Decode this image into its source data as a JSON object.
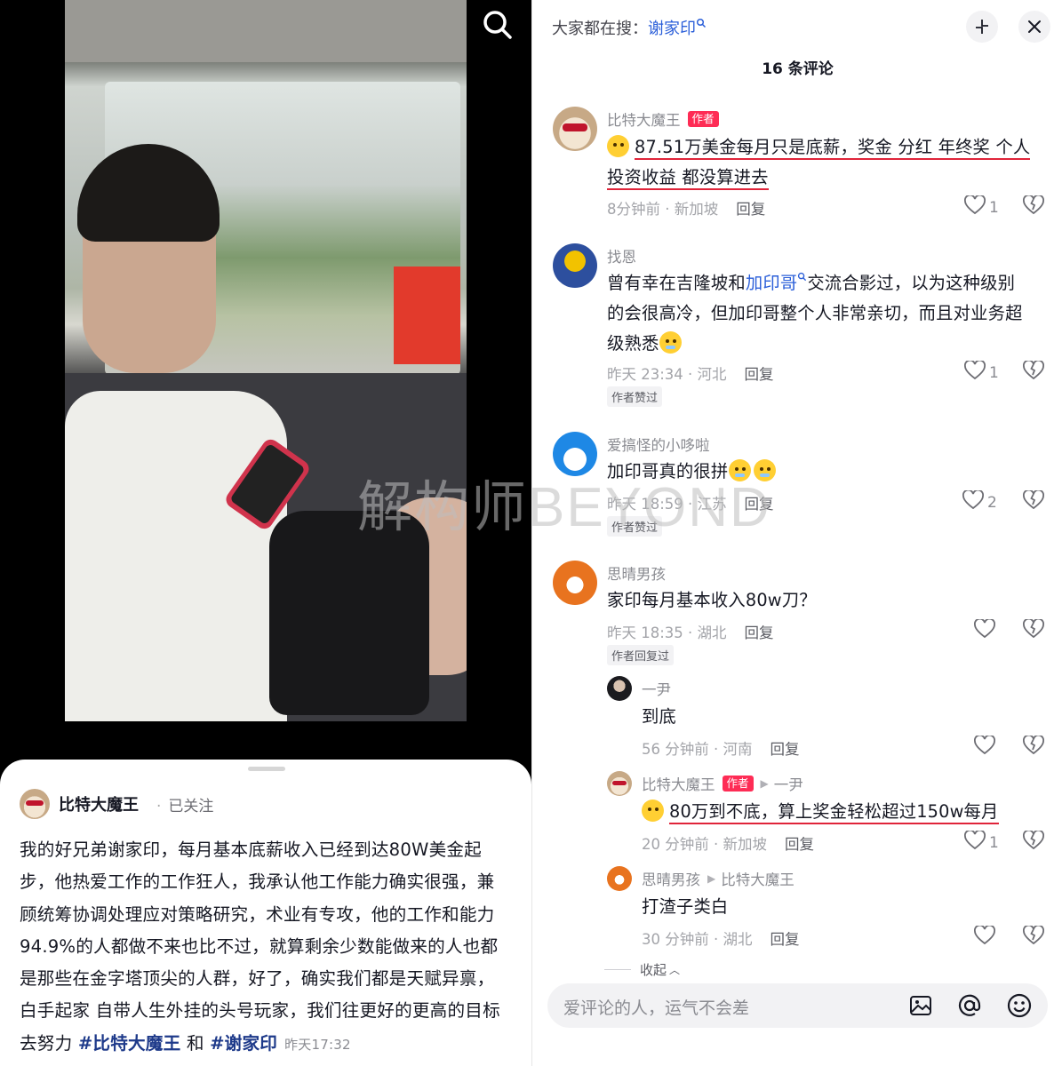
{
  "post": {
    "author": "比特大魔王",
    "follow_status": "已关注",
    "text": "我的好兄弟谢家印，每月基本底薪收入已经到达80W美金起步，他热爱工作的工作狂人，我承认他工作能力确实很强，兼顾统筹协调处理应对策略研究，术业有专攻，他的工作和能力94.9%的人都做不来也比不过，就算剩余少数能做来的人也都是那些在金字塔顶尖的人群，好了，确实我们都是天赋异禀，白手起家 自带人生外挂的头号玩家，我们往更好的更高的目标去努力 ",
    "hashtag1": "#比特大魔王",
    "joiner": " 和 ",
    "hashtag2": "#谢家印",
    "time": "昨天17:32"
  },
  "comments_panel": {
    "search_prefix": "大家都在搜：",
    "search_keyword": "谢家印",
    "count_label": "16 条评论",
    "collapse_label": "收起",
    "input_placeholder": "爱评论的人，运气不会差",
    "author_tag": "作者"
  },
  "comments": [
    {
      "name": "比特大魔王",
      "text": "87.51万美金每月只是底薪，奖金 分红 年终奖 个人投资收益 都没算进去",
      "line1": "87.51万美金每月只是底薪，奖金 分红 年终奖 个人",
      "line2": "投资收益 都没算进去",
      "meta": "8分钟前 · 新加坡",
      "reply": "回复",
      "likes": "1"
    },
    {
      "name": "找恩",
      "text_a": "曾有幸在吉隆坡和",
      "link": "加印哥",
      "text_b": "交流合影过，以为这种级别",
      "line2": "的会很高冷，但加印哥整个人非常亲切，而且对业务超",
      "line3": "级熟悉",
      "meta": "昨天 23:34 · 河北",
      "reply": "回复",
      "likes": "1",
      "badge": "作者赞过"
    },
    {
      "name": "爱搞怪的小哆啦",
      "text": "加印哥真的很拼",
      "meta": "昨天 18:59 · 江苏",
      "reply": "回复",
      "likes": "2",
      "badge": "作者赞过"
    },
    {
      "name": "思晴男孩",
      "text": "家印每月基本收入80w刀？",
      "meta": "昨天 18:35 · 湖北",
      "reply": "回复",
      "badge": "作者回复过"
    }
  ],
  "replies": [
    {
      "name": "一尹",
      "text": "到底",
      "meta": "56 分钟前 · 河南",
      "reply": "回复"
    },
    {
      "name": "比特大魔王",
      "to": "一尹",
      "text": "80万到不底，算上奖金轻松超过150w每月",
      "meta": "20 分钟前 · 新加坡",
      "reply": "回复",
      "likes": "1"
    },
    {
      "name": "思晴男孩",
      "to": "比特大魔王",
      "text": "打渣子类白",
      "meta": "30 分钟前 · 湖北",
      "reply": "回复"
    }
  ],
  "watermark": "解构师BEYOND",
  "icons": [
    "search-icon",
    "collapse-icon",
    "close-icon",
    "heart-icon",
    "dislike-icon",
    "image-icon",
    "at-icon",
    "emoji-icon",
    "search-small-icon"
  ]
}
